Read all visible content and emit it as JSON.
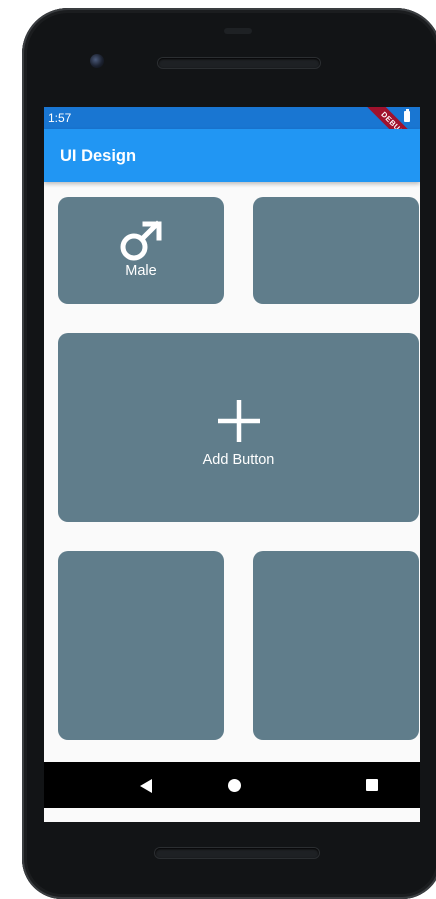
{
  "status_bar": {
    "time": "1:57",
    "debug_banner": "DEBUG"
  },
  "app_bar": {
    "title": "UI Design"
  },
  "cards": {
    "male": {
      "label": "Male",
      "icon": "male-icon"
    },
    "add": {
      "label": "Add Button",
      "icon": "plus-icon"
    }
  },
  "nav_bar": {
    "icons": [
      "back-icon",
      "home-icon",
      "recents-icon"
    ]
  },
  "colors": {
    "status_bar": "#1976d2",
    "app_bar": "#2196f3",
    "card": "#607d8b",
    "background": "#fafafa"
  }
}
